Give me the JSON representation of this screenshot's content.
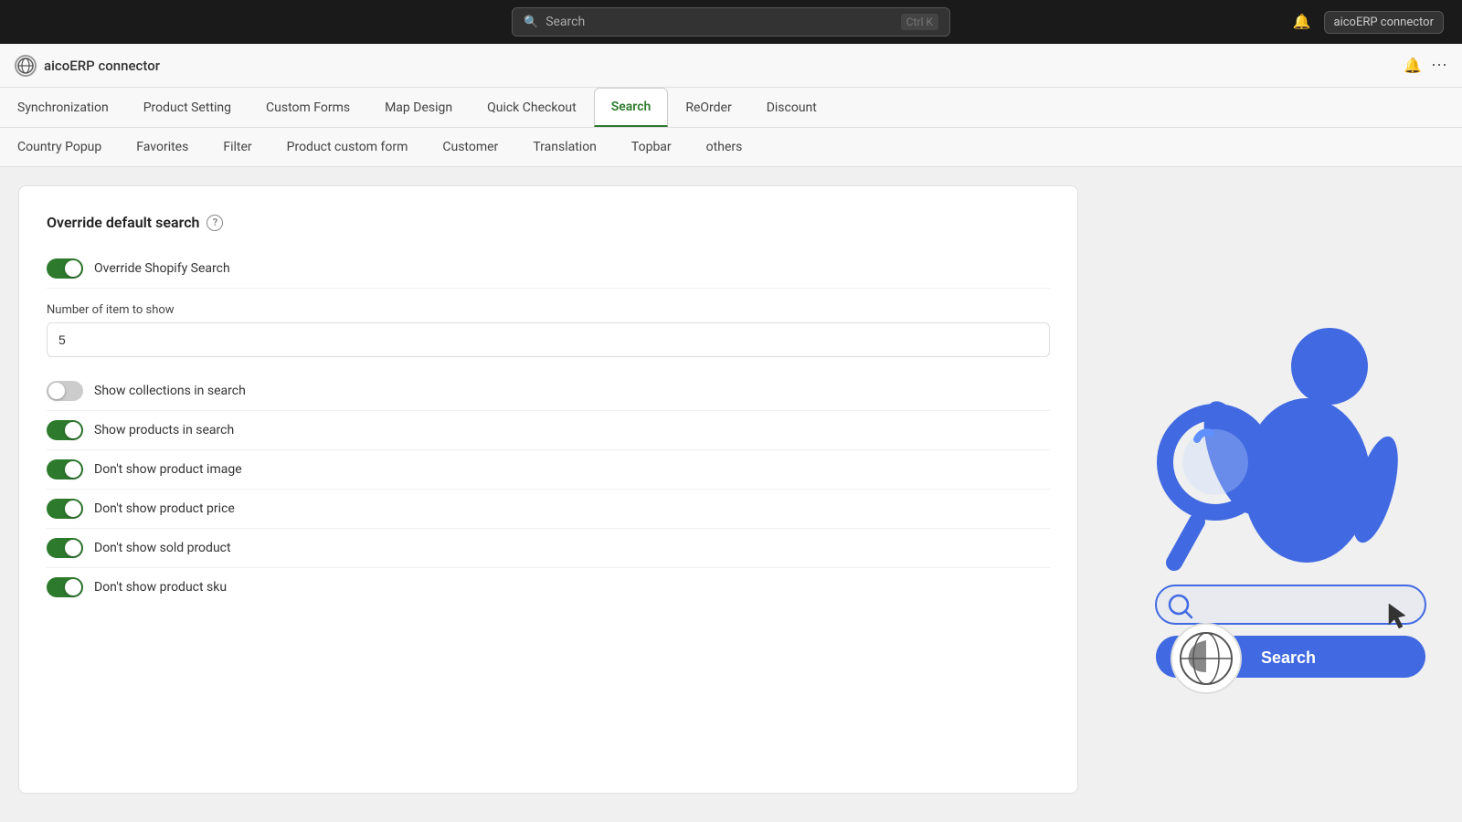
{
  "topbar": {
    "search_placeholder": "Search",
    "shortcut": "Ctrl K",
    "bell_icon": "🔔",
    "user_label": "aicoERP connector"
  },
  "app_header": {
    "title": "aicoERP connector",
    "bell_icon": "🔔",
    "more_icon": "⋯"
  },
  "tabs_row1": [
    {
      "id": "synchronization",
      "label": "Synchronization",
      "active": false
    },
    {
      "id": "product-setting",
      "label": "Product Setting",
      "active": false
    },
    {
      "id": "custom-forms",
      "label": "Custom Forms",
      "active": false
    },
    {
      "id": "map-design",
      "label": "Map Design",
      "active": false
    },
    {
      "id": "quick-checkout",
      "label": "Quick Checkout",
      "active": false
    },
    {
      "id": "search",
      "label": "Search",
      "active": true
    },
    {
      "id": "reorder",
      "label": "ReOrder",
      "active": false
    },
    {
      "id": "discount",
      "label": "Discount",
      "active": false
    }
  ],
  "tabs_row2": [
    {
      "id": "country-popup",
      "label": "Country Popup",
      "active": false
    },
    {
      "id": "favorites",
      "label": "Favorites",
      "active": false
    },
    {
      "id": "filter",
      "label": "Filter",
      "active": false
    },
    {
      "id": "product-custom-form",
      "label": "Product custom form",
      "active": false
    },
    {
      "id": "customer",
      "label": "Customer",
      "active": false
    },
    {
      "id": "translation",
      "label": "Translation",
      "active": false
    },
    {
      "id": "topbar",
      "label": "Topbar",
      "active": false
    },
    {
      "id": "others",
      "label": "others",
      "active": false
    }
  ],
  "settings": {
    "section_title": "Override default search",
    "help_icon": "?",
    "fields": [
      {
        "id": "override-shopify",
        "label": "Override Shopify Search",
        "enabled": true
      },
      {
        "id": "show-collections",
        "label": "Show collections in search",
        "enabled": false
      },
      {
        "id": "show-products",
        "label": "Show products in search",
        "enabled": true
      },
      {
        "id": "dont-show-image",
        "label": "Don't show product image",
        "enabled": true
      },
      {
        "id": "dont-show-price",
        "label": "Don't show product price",
        "enabled": true
      },
      {
        "id": "dont-show-sold",
        "label": "Don't show sold product",
        "enabled": true
      },
      {
        "id": "dont-show-sku",
        "label": "Don't show product sku",
        "enabled": true
      }
    ],
    "number_input": {
      "label": "Number of item to show",
      "value": "5"
    }
  },
  "illustration": {
    "search_button_text": "Search"
  },
  "colors": {
    "active_tab": "#2d7a2d",
    "toggle_on": "#2d7a2d",
    "toggle_off": "#ccc",
    "blue": "#3d6fd4",
    "illustration_blue": "#4169e1"
  }
}
